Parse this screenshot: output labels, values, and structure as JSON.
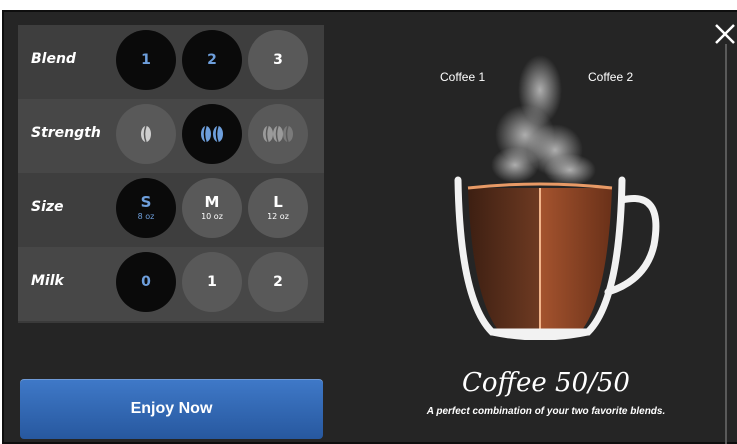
{
  "options": {
    "blend": {
      "label": "Blend",
      "choices": [
        "1",
        "2",
        "3"
      ],
      "selected": [
        "1",
        "2"
      ]
    },
    "strength": {
      "label": "Strength",
      "choices": [
        "bean-1-icon",
        "bean-2-icon",
        "bean-3-icon"
      ],
      "selected": "bean-2-icon"
    },
    "size": {
      "label": "Size",
      "choices": [
        {
          "letter": "S",
          "volume": "8 oz"
        },
        {
          "letter": "M",
          "volume": "10 oz"
        },
        {
          "letter": "L",
          "volume": "12 oz"
        }
      ],
      "selected": "S"
    },
    "milk": {
      "label": "Milk",
      "choices": [
        "0",
        "1",
        "2"
      ],
      "selected": "0"
    }
  },
  "action": {
    "enjoy_label": "Enjoy Now"
  },
  "mug": {
    "left_label": "Coffee 1",
    "right_label": "Coffee 2"
  },
  "product": {
    "name": "Coffee 50/50",
    "description": "A perfect combination of your two favorite blends."
  },
  "colors": {
    "accent": "#6e9fdc",
    "button": "#3a72c2",
    "panel": "#252525"
  }
}
